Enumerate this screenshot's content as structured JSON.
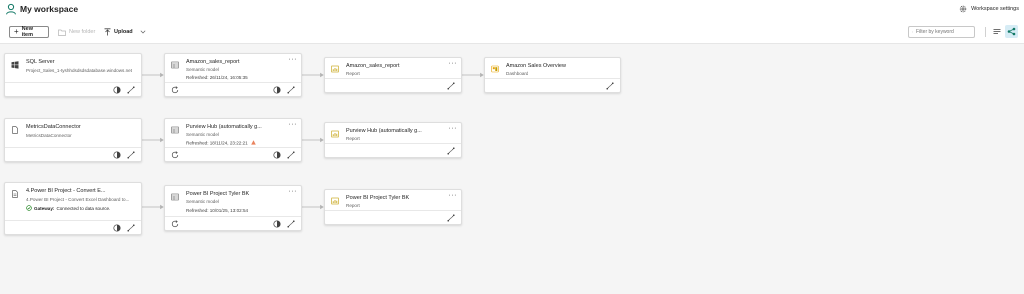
{
  "header": {
    "title": "My workspace",
    "settings_label": "Workspace settings"
  },
  "toolbar": {
    "new_item_label": "New item",
    "new_folder_label": "New folder",
    "upload_label": "Upload",
    "filter_placeholder": "Filter by keyword"
  },
  "colors": {
    "accent": "#117865",
    "dataset_icon": "#616161",
    "report_icon": "#c19c00",
    "dashboard_icon": "#e8a100",
    "warning": "#e9835e",
    "gateway_ok": "#107c10"
  },
  "rows": [
    {
      "source": {
        "title": "SQL Server",
        "subtitle": "Project_Sales_1-tyshhdsdsdsdatabase.windows.net",
        "icon": "windows-icon"
      },
      "model": {
        "title": "Amazon_sales_report",
        "type": "Semantic model",
        "refreshed": "Refreshed: 26/11/24, 16:05:35"
      },
      "report": {
        "title": "Amazon_sales_report",
        "type": "Report"
      },
      "dashboard": {
        "title": "Amazon Sales Overview",
        "type": "Dashboard"
      }
    },
    {
      "source": {
        "title": "MetricsDataConnector",
        "subtitle": "MetricsDataConnector",
        "icon": "connector-icon"
      },
      "model": {
        "title": "Purview Hub (automatically g...",
        "type": "Semantic model",
        "refreshed": "Refreshed: 18/11/24, 23:22:21"
      },
      "report": {
        "title": "Purview Hub (automatically g...",
        "type": "Report"
      }
    },
    {
      "source": {
        "title": "4.Power BI Project - Convert E...",
        "subtitle": "4.Power BI Project - Convert Excel Dashboard to...",
        "icon": "file-icon",
        "gateway_label": "Gateway:",
        "gateway_status": "Connected to data source."
      },
      "model": {
        "title": "Power BI Project Tyler BK",
        "type": "Semantic model",
        "refreshed": "Refreshed: 10/01/25, 13:02:54"
      },
      "report": {
        "title": "Power BI Project Tyler BK",
        "type": "Report"
      }
    }
  ]
}
